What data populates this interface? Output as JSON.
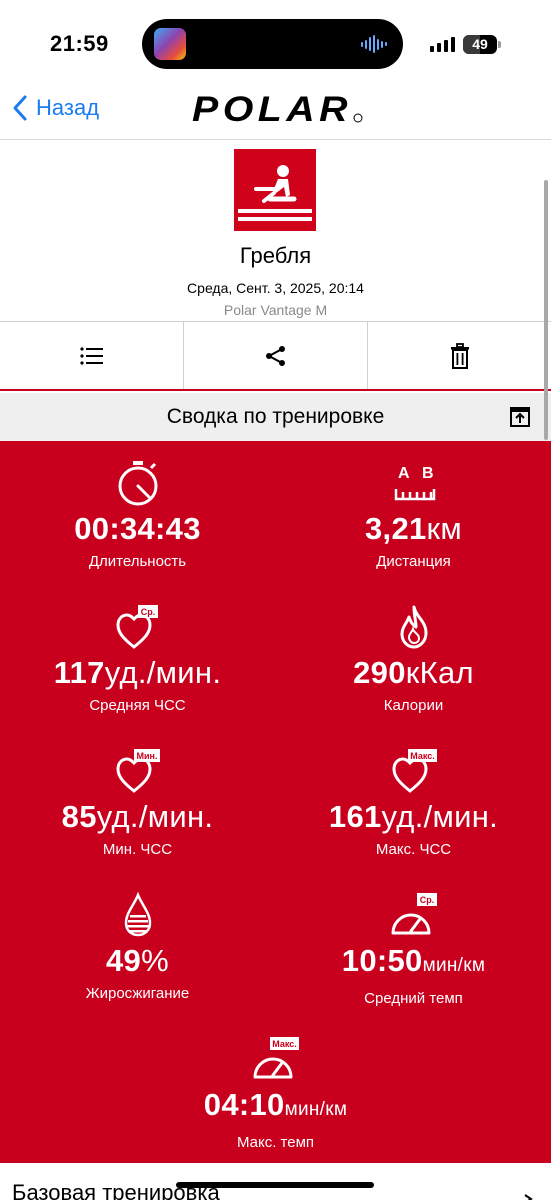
{
  "status": {
    "time": "21:59",
    "battery": "49"
  },
  "nav": {
    "back_label": "Назад",
    "logo_text": "POLAR"
  },
  "header": {
    "sport_name": "Гребля",
    "date": "Среда, Сент. 3, 2025, 20:14",
    "device": "Polar Vantage M"
  },
  "actions": {
    "list_icon": "list-icon",
    "share_icon": "share-icon",
    "delete_icon": "trash-icon"
  },
  "summary": {
    "title": "Сводка по тренировке"
  },
  "stats": {
    "duration": {
      "value": "00:34:43",
      "unit": "",
      "label": "Длительность"
    },
    "distance": {
      "value": "3,21",
      "unit": "км",
      "label": "Дистанция",
      "icon_text": "A B"
    },
    "avg_hr": {
      "value": "117",
      "unit": "уд./мин.",
      "label": "Средняя ЧСС",
      "badge": "Ср."
    },
    "calories": {
      "value": "290",
      "unit": "кКал",
      "label": "Калории"
    },
    "min_hr": {
      "value": "85",
      "unit": "уд./мин.",
      "label": "Мин. ЧСС",
      "badge": "Мин."
    },
    "max_hr": {
      "value": "161",
      "unit": "уд./мин.",
      "label": "Макс. ЧСС",
      "badge": "Макс."
    },
    "fat_burn": {
      "value": "49",
      "unit": "%",
      "label": "Жиросжигание"
    },
    "avg_pace": {
      "value": "10:50",
      "unit": "мин/км",
      "label": "Средний темп",
      "badge": "Ср."
    },
    "max_pace": {
      "value": "04:10",
      "unit": "мин/км",
      "label": "Макс. темп",
      "badge": "Макс."
    }
  },
  "bottom": {
    "title": "Базовая тренировка"
  },
  "colors": {
    "brand_red": "#c8001e",
    "link_blue": "#1a7cf0"
  }
}
